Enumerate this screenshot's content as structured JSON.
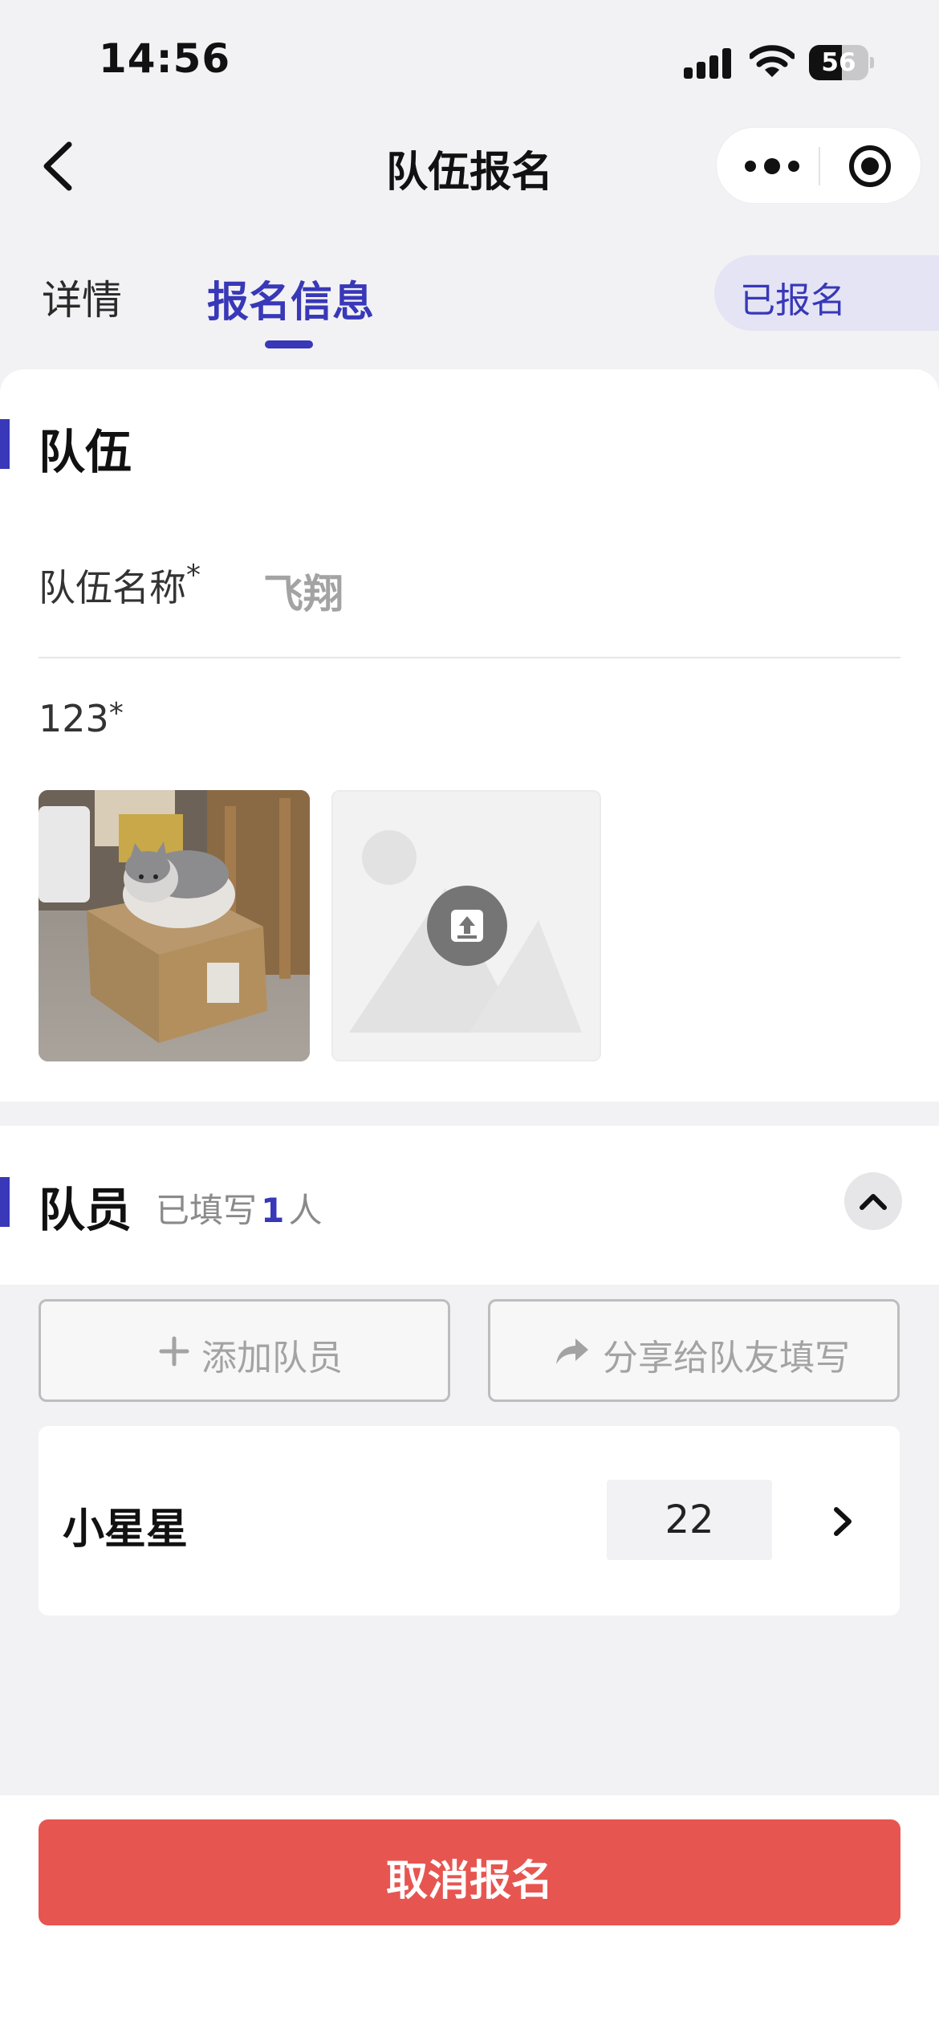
{
  "status_bar": {
    "time": "14:56",
    "battery": "56",
    "battery_level": 0.56
  },
  "nav": {
    "title": "队伍报名"
  },
  "tabs": [
    {
      "label": "详情",
      "active": false
    },
    {
      "label": "报名信息",
      "active": true
    }
  ],
  "status_pill": "已报名",
  "team_section": {
    "title": "队伍",
    "name_label": "队伍名称",
    "name_required": "*",
    "name_value": "飞翔",
    "image_label": "123",
    "image_required": "*"
  },
  "members_section": {
    "title": "队员",
    "filled_prefix": "已填写",
    "filled_count": "1",
    "filled_suffix": "人",
    "add_label": "添加队员",
    "share_label": "分享给队友填写",
    "members": [
      {
        "name": "小星星",
        "age": "22"
      }
    ]
  },
  "cancel_label": "取消报名",
  "colors": {
    "accent": "#3838b8",
    "danger": "#e75550",
    "pill_bg": "#e4e4f4"
  }
}
